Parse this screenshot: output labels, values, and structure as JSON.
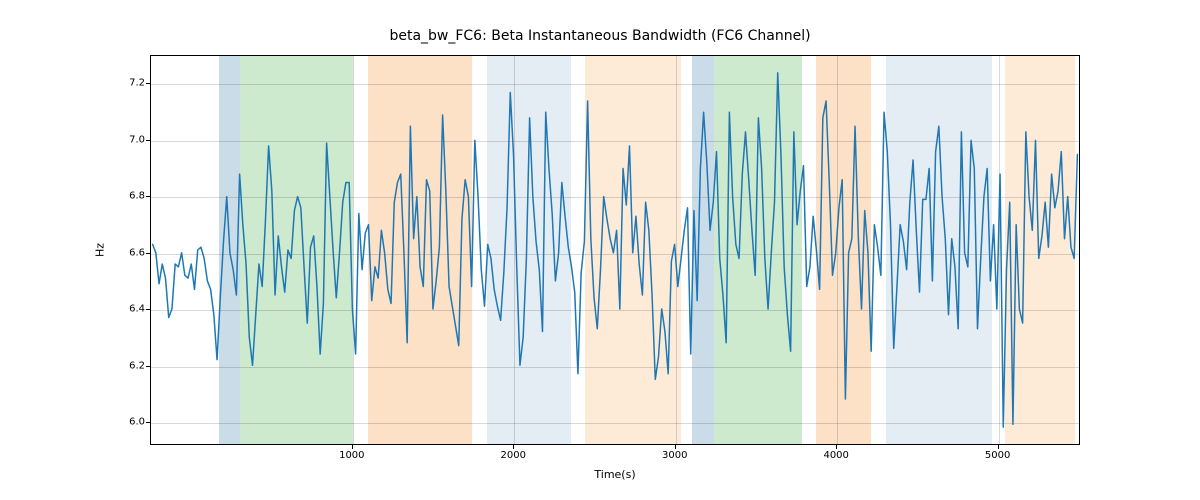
{
  "chart_data": {
    "type": "line",
    "title": "beta_bw_FC6: Beta Instantaneous Bandwidth (FC6 Channel)",
    "xlabel": "Time(s)",
    "ylabel": "Hz",
    "xlim": [
      -250,
      5510
    ],
    "ylim": [
      5.92,
      7.3
    ],
    "xticks": [
      1000,
      2000,
      3000,
      4000,
      5000
    ],
    "yticks": [
      6.0,
      6.2,
      6.4,
      6.6,
      6.8,
      7.0,
      7.2
    ],
    "grid": true,
    "bands": [
      {
        "x0": 170,
        "x1": 300,
        "color": "#6b9abf",
        "alpha": 0.35
      },
      {
        "x0": 300,
        "x1": 1000,
        "color": "#4caf50",
        "alpha": 0.28
      },
      {
        "x0": 1095,
        "x1": 1740,
        "color": "#f5a34d",
        "alpha": 0.32
      },
      {
        "x0": 1830,
        "x1": 2350,
        "color": "#6b9abf",
        "alpha": 0.18
      },
      {
        "x0": 2440,
        "x1": 3030,
        "color": "#f5a34d",
        "alpha": 0.22
      },
      {
        "x0": 3100,
        "x1": 3240,
        "color": "#6b9abf",
        "alpha": 0.35
      },
      {
        "x0": 3240,
        "x1": 3780,
        "color": "#4caf50",
        "alpha": 0.28
      },
      {
        "x0": 3870,
        "x1": 4210,
        "color": "#f5a34d",
        "alpha": 0.32
      },
      {
        "x0": 4300,
        "x1": 4960,
        "color": "#6b9abf",
        "alpha": 0.18
      },
      {
        "x0": 5040,
        "x1": 5470,
        "color": "#f5a34d",
        "alpha": 0.22
      }
    ],
    "series": [
      {
        "name": "beta_bw_FC6",
        "color": "#1f77b4",
        "x_step": 20,
        "x_start": -240,
        "values": [
          6.63,
          6.6,
          6.49,
          6.56,
          6.51,
          6.37,
          6.4,
          6.56,
          6.55,
          6.6,
          6.52,
          6.51,
          6.56,
          6.47,
          6.61,
          6.62,
          6.58,
          6.5,
          6.47,
          6.38,
          6.22,
          6.44,
          6.64,
          6.8,
          6.6,
          6.54,
          6.45,
          6.88,
          6.7,
          6.56,
          6.3,
          6.2,
          6.38,
          6.56,
          6.48,
          6.71,
          6.98,
          6.82,
          6.45,
          6.66,
          6.55,
          6.46,
          6.61,
          6.58,
          6.75,
          6.8,
          6.76,
          6.55,
          6.35,
          6.62,
          6.66,
          6.48,
          6.24,
          6.42,
          6.99,
          6.8,
          6.61,
          6.44,
          6.6,
          6.78,
          6.85,
          6.85,
          6.4,
          6.24,
          6.74,
          6.54,
          6.67,
          6.7,
          6.43,
          6.55,
          6.51,
          6.68,
          6.6,
          6.47,
          6.42,
          6.78,
          6.85,
          6.88,
          6.6,
          6.28,
          7.05,
          6.65,
          6.8,
          6.55,
          6.48,
          6.86,
          6.82,
          6.4,
          6.5,
          6.62,
          7.09,
          6.82,
          6.48,
          6.41,
          6.34,
          6.27,
          6.72,
          6.86,
          6.8,
          6.48,
          7.0,
          6.8,
          6.54,
          6.41,
          6.63,
          6.58,
          6.47,
          6.41,
          6.36,
          6.53,
          6.76,
          7.17,
          6.95,
          6.55,
          6.2,
          6.3,
          6.58,
          7.08,
          6.8,
          6.64,
          6.54,
          6.32,
          7.1,
          6.9,
          6.74,
          6.5,
          6.6,
          6.85,
          6.73,
          6.62,
          6.55,
          6.46,
          6.17,
          6.53,
          6.64,
          7.14,
          6.65,
          6.44,
          6.33,
          6.54,
          6.8,
          6.72,
          6.65,
          6.6,
          6.68,
          6.4,
          6.9,
          6.77,
          6.98,
          6.6,
          6.73,
          6.56,
          6.45,
          6.78,
          6.68,
          6.45,
          6.15,
          6.23,
          6.4,
          6.32,
          6.17,
          6.57,
          6.63,
          6.48,
          6.58,
          6.68,
          6.76,
          6.24,
          6.75,
          6.43,
          6.9,
          7.1,
          6.92,
          6.68,
          6.78,
          6.96,
          6.58,
          6.45,
          6.28,
          7.1,
          6.8,
          6.63,
          6.58,
          6.88,
          7.03,
          6.86,
          6.68,
          6.52,
          7.08,
          6.9,
          6.58,
          6.4,
          6.6,
          6.78,
          7.24,
          6.95,
          6.55,
          6.38,
          6.25,
          7.03,
          6.7,
          6.82,
          6.91,
          6.48,
          6.55,
          6.73,
          6.61,
          6.47,
          7.08,
          7.14,
          6.85,
          6.52,
          6.6,
          6.76,
          6.86,
          6.08,
          6.6,
          6.65,
          7.05,
          6.66,
          6.4,
          6.75,
          6.6,
          6.25,
          6.7,
          6.62,
          6.52,
          7.1,
          6.96,
          6.7,
          6.26,
          6.48,
          6.7,
          6.64,
          6.54,
          6.78,
          6.93,
          6.68,
          6.46,
          6.79,
          6.79,
          6.9,
          6.5,
          6.96,
          7.05,
          6.8,
          6.65,
          6.38,
          6.65,
          6.55,
          6.33,
          7.03,
          6.6,
          6.55,
          7.0,
          6.9,
          6.33,
          6.58,
          6.8,
          6.9,
          6.5,
          6.7,
          6.4,
          6.88,
          5.98,
          6.54,
          6.78,
          5.99,
          6.7,
          6.4,
          6.35,
          7.03,
          6.8,
          6.68,
          7.0,
          6.58,
          6.66,
          6.78,
          6.62,
          6.88,
          6.76,
          6.82,
          6.96,
          6.65,
          6.8,
          6.62,
          6.58,
          6.95
        ]
      }
    ]
  }
}
